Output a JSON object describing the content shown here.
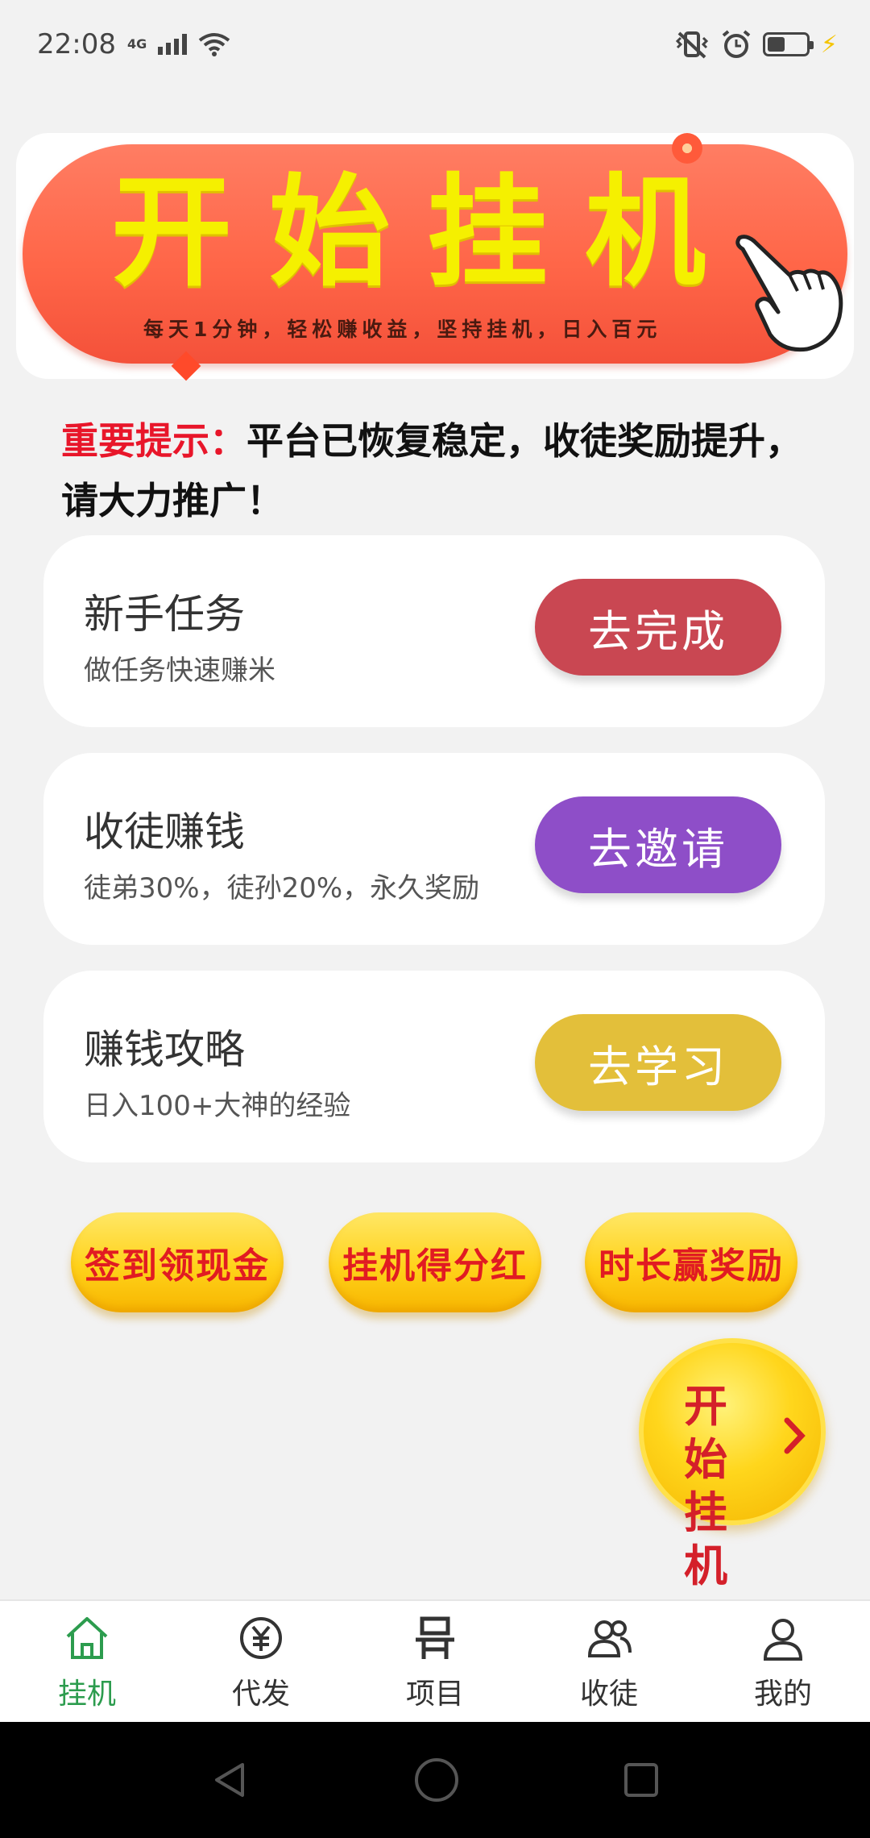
{
  "status": {
    "time": "22:08",
    "network": "4G"
  },
  "banner": {
    "title": "开始挂机",
    "subtitle": "每天1分钟，轻松赚收益，坚持挂机，日入百元"
  },
  "notice": {
    "label": "重要提示：",
    "text": "平台已恢复稳定，收徒奖励提升，请大力推广！"
  },
  "cards": [
    {
      "title": "新手任务",
      "subtitle": "做任务快速赚米",
      "button": "去完成",
      "color": "#c94752"
    },
    {
      "title": "收徒赚钱",
      "subtitle": "徒弟30%，徒孙20%，永久奖励",
      "button": "去邀请",
      "color": "#8e4ec8"
    },
    {
      "title": "赚钱攻略",
      "subtitle": "日入100+大神的经验",
      "button": "去学习",
      "color": "#e3bf3a"
    }
  ],
  "pills": [
    "签到领现金",
    "挂机得分红",
    "时长赢奖励"
  ],
  "float_button": {
    "line1": "开始",
    "line2": "挂机"
  },
  "nav": [
    {
      "label": "挂机",
      "icon": "home-icon",
      "active": true
    },
    {
      "label": "代发",
      "icon": "yuan-icon",
      "active": false
    },
    {
      "label": "项目",
      "icon": "project-icon",
      "active": false
    },
    {
      "label": "收徒",
      "icon": "users-icon",
      "active": false
    },
    {
      "label": "我的",
      "icon": "user-icon",
      "active": false
    }
  ],
  "colors": {
    "accent_green": "#2c9c4e",
    "notice_red": "#e8162a",
    "banner_orange": "#ff6648",
    "banner_text_yellow": "#f5f000"
  }
}
